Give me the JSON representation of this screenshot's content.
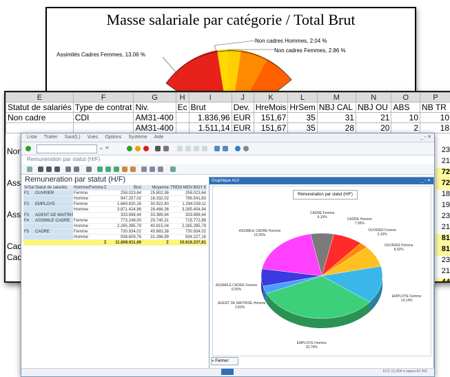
{
  "back_chart": {
    "title": "Masse salariale par catégorie / Total Brut",
    "labels": [
      {
        "text": "Non cadres Hommes, 2.04 %"
      },
      {
        "text": "Non cadres Femmes, 2.86 %"
      },
      {
        "text": "Assimilés Cadres Femmes, 13.06 %"
      }
    ],
    "colors": {
      "red": "#e8221a",
      "yellow": "#ffd800",
      "orange": "#ff8a00"
    }
  },
  "sheet": {
    "columns": [
      "E",
      "F",
      "G",
      "H",
      "I",
      "J",
      "K",
      "L",
      "M",
      "N",
      "O",
      "P"
    ],
    "header": [
      "Statut de salariés",
      "Type de contrat",
      "Niv.",
      "Ec",
      "Brut",
      "Dev.",
      "HreMois",
      "HrSem",
      "NBJ CAL",
      "NBJ OU",
      "ABS",
      "NB TR"
    ],
    "rows": [
      [
        "Non cadre",
        "CDI",
        "AM31-400",
        "",
        "1.836,96",
        "EUR",
        "151,67",
        "35",
        "31",
        "21",
        "10",
        "10"
      ],
      [
        "",
        "",
        "AM31-400",
        "",
        "1.511,14",
        "EUR",
        "151,67",
        "35",
        "28",
        "20",
        "2",
        "18"
      ]
    ],
    "left_fragments": [
      "Non",
      "Assi",
      "Assi",
      "Cad",
      "Cad"
    ],
    "right_values": [
      "23",
      "21",
      "72",
      "72",
      "18",
      "19",
      "23",
      "21",
      "81",
      "81",
      "23",
      "21",
      "44",
      "44"
    ]
  },
  "sap": {
    "menu": [
      "Liste",
      "Traiter",
      "Saut(L)",
      "Vues",
      "Options",
      "Système",
      "Aide"
    ],
    "subtitle": "Remuneration par statut (H/F)",
    "report_title": "Remuneration par statut (H/F)",
    "grid_header": [
      "SrSal",
      "Statut de salariés",
      "Homme/Femme",
      "Σ",
      "Brut",
      "Moyenne",
      "TREM MEN MOY EUR"
    ],
    "grid_rows": [
      [
        "F1",
        "OUVRIER",
        "Femme",
        "",
        "258.023,64",
        "25.802,36",
        "258.023,64"
      ],
      [
        "",
        "",
        "Homme",
        "",
        "947.257,02",
        "16.332,02",
        "786.541,83"
      ],
      [
        "F2",
        "EMPLOYE",
        "Femme",
        "",
        "1.669.820,16",
        "30.922,60",
        "1.294.039,11"
      ],
      [
        "",
        "",
        "Homme",
        "",
        "3.871.424,86",
        "28.466,36",
        "3.285.404,94"
      ],
      [
        "F3",
        "AGENT DE MAITRISE",
        "",
        "",
        "333.898,44",
        "33.389,84",
        "333.898,44"
      ],
      [
        "F4",
        "ASSIMILE CADRE",
        "Femme",
        "",
        "773.248,00",
        "29.740,31",
        "715.772,88"
      ],
      [
        "",
        "",
        "Homme",
        "",
        "2.285.395,79",
        "40.815,04",
        "2.285.395,79"
      ],
      [
        "F5",
        "CADRE",
        "Femme",
        "",
        "730.934,02",
        "45.683,38",
        "730.934,02"
      ],
      [
        "",
        "",
        "Homme",
        "",
        "938.609,76",
        "31.286,99",
        "934.227,16"
      ]
    ],
    "grid_total": [
      "",
      "",
      "",
      "Σ",
      "11.808.611,69",
      "Σ",
      "10.618.237,81"
    ],
    "alv_window_title": "Graphique ALV",
    "alv_chart_title": "Rémunération par statut (H/F)",
    "pie": [
      {
        "label": "CADRE Femme",
        "pct": "6,19%",
        "value": 6.19,
        "color": "#7a7a7a"
      },
      {
        "label": "CADRE Homme",
        "pct": "7,95%",
        "value": 7.95,
        "color": "#ff2a2a"
      },
      {
        "label": "OUVRIER Femme",
        "pct": "2,19%",
        "value": 2.19,
        "color": "#ff8c00"
      },
      {
        "label": "OUVRIER Homme",
        "pct": "8,02%",
        "value": 8.02,
        "color": "#ffc020"
      },
      {
        "label": "EMPLOYE Femme",
        "pct": "14,14%",
        "value": 14.14,
        "color": "#3ab7e8"
      },
      {
        "label": "EMPLOYE Homme",
        "pct": "32,78%",
        "value": 32.78,
        "color": "#3cd07a"
      },
      {
        "label": "AGENT DE MAITRISE Homme",
        "pct": "2,83%",
        "value": 2.83,
        "color": "#48a0ff"
      },
      {
        "label": "ASSIMILE CADRE Femme",
        "pct": "6,55%",
        "value": 6.55,
        "color": "#3a3ae0"
      },
      {
        "label": "ASSIMILE CADRE Homme",
        "pct": "19,35%",
        "value": 19.35,
        "color": "#ff40ff"
      }
    ],
    "fermer_label": "Fermer",
    "status": "ECC (1) 800 ▾  sapecc62  INS"
  }
}
